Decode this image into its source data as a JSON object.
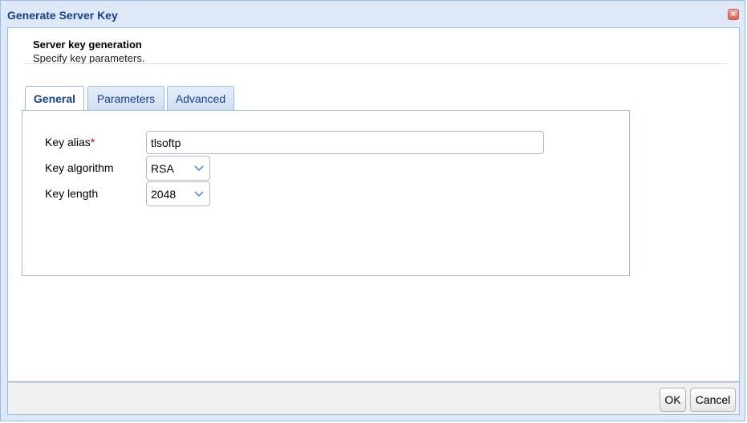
{
  "window": {
    "title": "Generate Server Key",
    "close_icon": "close-icon"
  },
  "header": {
    "title": "Server key generation",
    "subtitle": "Specify key parameters."
  },
  "tabs": [
    {
      "label": "General",
      "active": true
    },
    {
      "label": "Parameters",
      "active": false
    },
    {
      "label": "Advanced",
      "active": false
    }
  ],
  "form": {
    "key_alias": {
      "label": "Key alias",
      "required_mark": "*",
      "value": "tlsoftp"
    },
    "key_algorithm": {
      "label": "Key algorithm",
      "value": "RSA"
    },
    "key_length": {
      "label": "Key length",
      "value": "2048"
    }
  },
  "footer": {
    "ok_label": "OK",
    "cancel_label": "Cancel"
  },
  "colors": {
    "title_text": "#15428b",
    "border": "#99bbe8",
    "window_bg": "#dfe8f6",
    "required": "#c00000"
  }
}
